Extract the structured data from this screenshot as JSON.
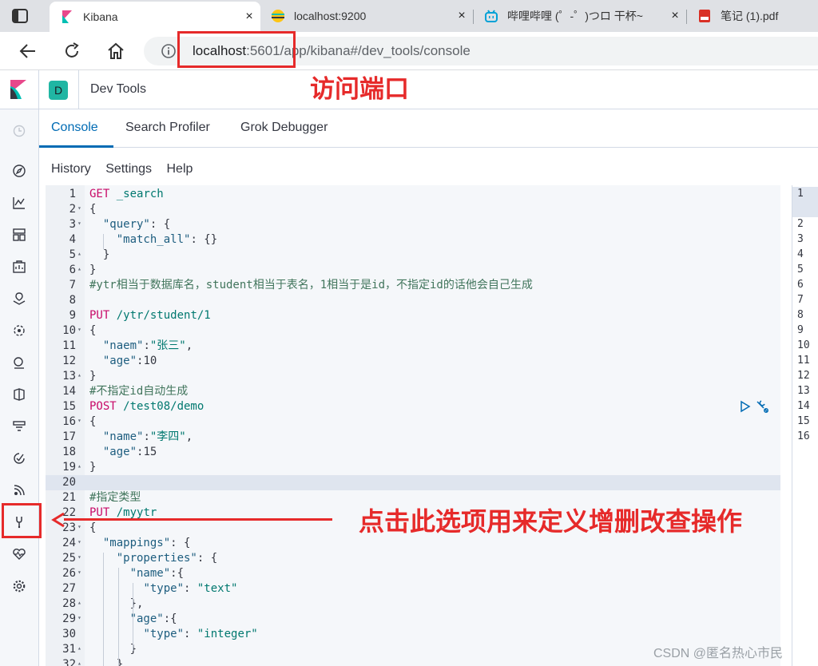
{
  "browser": {
    "tabs": [
      {
        "title": "Kibana",
        "active": true,
        "icon": "kibana-icon"
      },
      {
        "title": "localhost:9200",
        "active": false,
        "icon": "elastic-icon"
      },
      {
        "title": "哔哩哔哩 (゜-゜)つロ 干杯~",
        "active": false,
        "icon": "bilibili-icon"
      },
      {
        "title": "笔记 (1).pdf",
        "active": false,
        "icon": "pdf-icon"
      }
    ],
    "close_glyph": "×",
    "url_host": "localhost",
    "url_rest": ":5601/app/kibana#/dev_tools/console"
  },
  "kibana": {
    "space_letter": "D",
    "app_title": "Dev Tools",
    "tabs": [
      "Console",
      "Search Profiler",
      "Grok Debugger"
    ],
    "menu": [
      "History",
      "Settings",
      "Help"
    ]
  },
  "editor": {
    "lines": [
      {
        "n": "1",
        "fold": "",
        "text": "GET _search"
      },
      {
        "n": "2",
        "fold": "▾",
        "text": "{"
      },
      {
        "n": "3",
        "fold": "▾",
        "text": "  \"query\": {"
      },
      {
        "n": "4",
        "fold": "",
        "text": "    \"match_all\": {}"
      },
      {
        "n": "5",
        "fold": "▴",
        "text": "  }"
      },
      {
        "n": "6",
        "fold": "▴",
        "text": "}"
      },
      {
        "n": "7",
        "fold": "",
        "text": "#ytr相当于数据库名，student相当于表名，1相当于是id，不指定id的话他会自己生成"
      },
      {
        "n": "8",
        "fold": "",
        "text": ""
      },
      {
        "n": "9",
        "fold": "",
        "text": "PUT /ytr/student/1"
      },
      {
        "n": "10",
        "fold": "▾",
        "text": "{"
      },
      {
        "n": "11",
        "fold": "",
        "text": "  \"naem\":\"张三\","
      },
      {
        "n": "12",
        "fold": "",
        "text": "  \"age\":10"
      },
      {
        "n": "13",
        "fold": "▴",
        "text": "}"
      },
      {
        "n": "14",
        "fold": "",
        "text": "#不指定id自动生成"
      },
      {
        "n": "15",
        "fold": "",
        "text": "POST /test08/demo"
      },
      {
        "n": "16",
        "fold": "▾",
        "text": "{"
      },
      {
        "n": "17",
        "fold": "",
        "text": "  \"name\":\"李四\","
      },
      {
        "n": "18",
        "fold": "",
        "text": "  \"age\":15"
      },
      {
        "n": "19",
        "fold": "▴",
        "text": "}"
      },
      {
        "n": "20",
        "fold": "",
        "text": ""
      },
      {
        "n": "21",
        "fold": "",
        "text": "#指定类型"
      },
      {
        "n": "22",
        "fold": "",
        "text": "PUT /myytr"
      },
      {
        "n": "23",
        "fold": "▾",
        "text": "{"
      },
      {
        "n": "24",
        "fold": "▾",
        "text": "  \"mappings\": {"
      },
      {
        "n": "25",
        "fold": "▾",
        "text": "    \"properties\": {"
      },
      {
        "n": "26",
        "fold": "▾",
        "text": "      \"name\":{"
      },
      {
        "n": "27",
        "fold": "",
        "text": "        \"type\": \"text\""
      },
      {
        "n": "28",
        "fold": "▴",
        "text": "      },"
      },
      {
        "n": "29",
        "fold": "▾",
        "text": "      \"age\":{"
      },
      {
        "n": "30",
        "fold": "",
        "text": "        \"type\": \"integer\""
      },
      {
        "n": "31",
        "fold": "▴",
        "text": "      }"
      },
      {
        "n": "32",
        "fold": "▴",
        "text": "    }"
      }
    ],
    "highlighted_line": "20"
  },
  "output": {
    "line_numbers": [
      "1",
      "",
      "2",
      "3",
      "4",
      "5",
      "6",
      "7",
      "8",
      "9",
      "10",
      "11",
      "12",
      "13",
      "14",
      "15",
      "16"
    ]
  },
  "annotations": {
    "port_note": "访问端口",
    "devtools_note": "点击此选项用来定义增删改查操作",
    "color": "#e62a2a"
  },
  "watermark": "CSDN @匿名热心市民",
  "colors": {
    "accent": "#006bb4",
    "method": "#c80a68",
    "string": "#00786f",
    "space_badge": "#20b6a3"
  }
}
